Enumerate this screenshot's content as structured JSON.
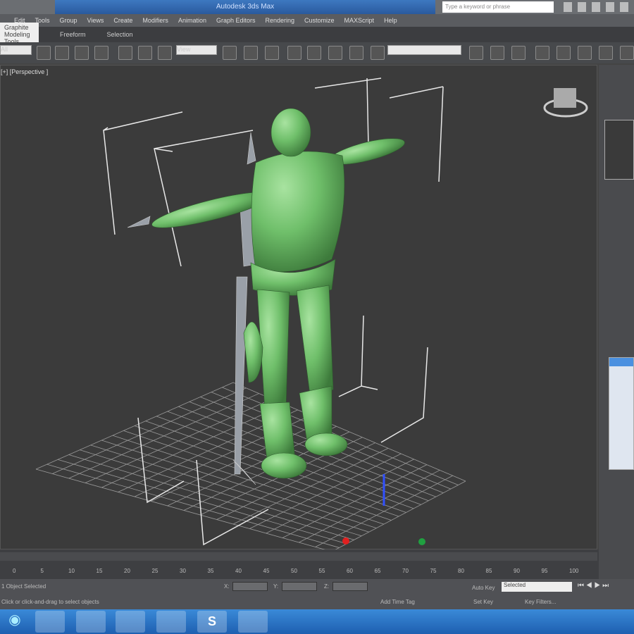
{
  "window": {
    "title": "Autodesk 3ds Max",
    "search_placeholder": "Type a keyword or phrase"
  },
  "menu": [
    "Edit",
    "Tools",
    "Group",
    "Views",
    "Create",
    "Modifiers",
    "Animation",
    "Graph Editors",
    "Rendering",
    "Customize",
    "MAXScript",
    "Help"
  ],
  "ribbon": {
    "tabs": [
      "Graphite Modeling Tools",
      "Freeform",
      "Selection"
    ]
  },
  "toolbar": {
    "selection_filter": "All",
    "ref_coord": "View"
  },
  "viewport": {
    "label": "[+] [Perspective ]",
    "model_color": "#6fbf6a",
    "background": "#3b3b3b"
  },
  "timeline": {
    "ticks": [
      "0",
      "5",
      "10",
      "15",
      "20",
      "25",
      "30",
      "35",
      "40",
      "45",
      "50",
      "55",
      "60",
      "65",
      "70",
      "75",
      "80",
      "85",
      "90",
      "95",
      "100"
    ]
  },
  "status": {
    "selection": "1 Object Selected",
    "prompt": "Click or click-and-drag to select objects",
    "x_label": "X:",
    "y_label": "Y:",
    "z_label": "Z:",
    "add_time_tag": "Add Time Tag",
    "auto_key": "Auto Key",
    "key_mode": "Selected",
    "set_key": "Set Key",
    "key_filters": "Key Filters..."
  },
  "taskbar": {
    "apps": [
      "ie-icon",
      "explorer-icon",
      "media-icon",
      "app-icon",
      "paint-icon",
      "skype-icon",
      "3dsmax-icon"
    ],
    "skype_letter": "S"
  }
}
